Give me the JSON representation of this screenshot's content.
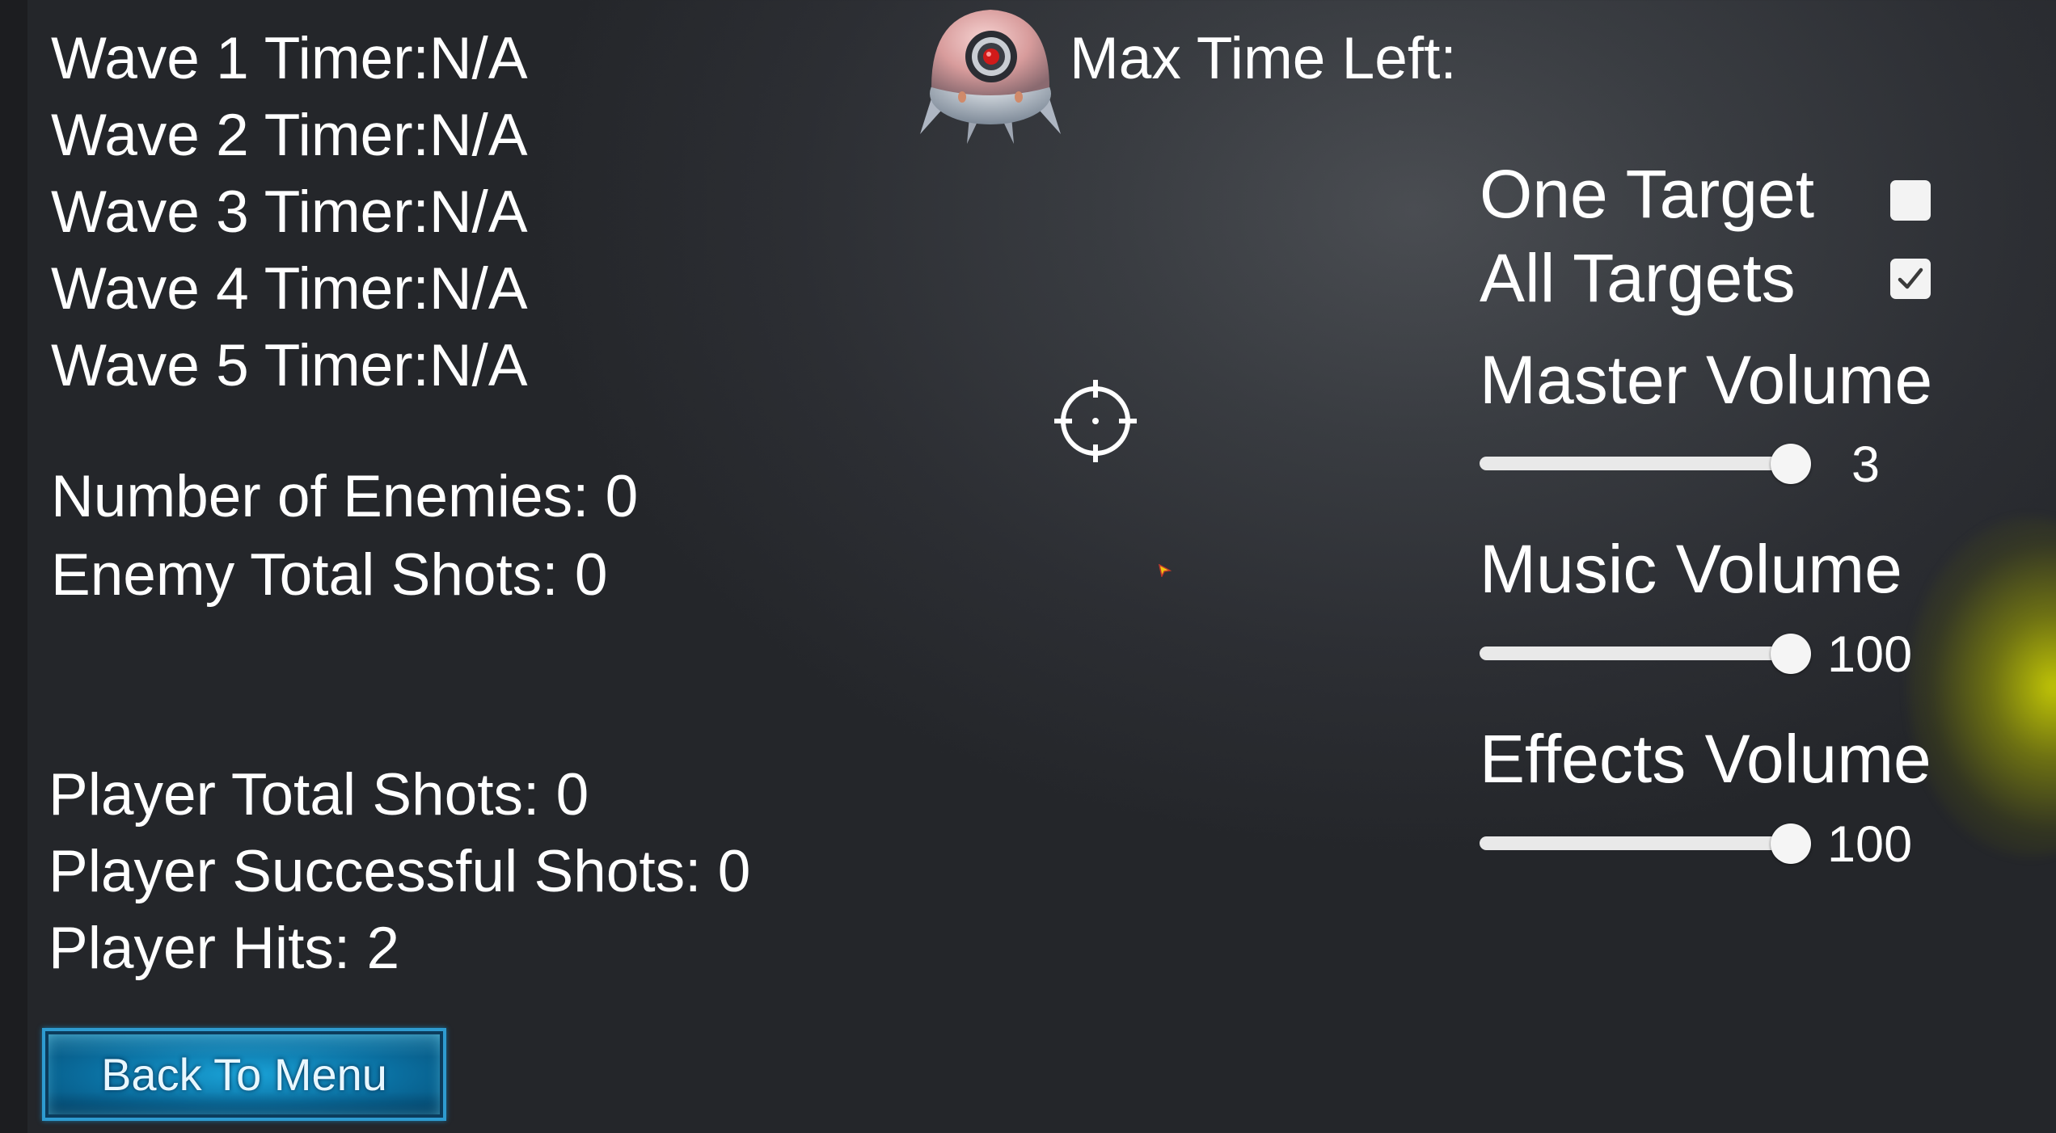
{
  "hud": {
    "wave_timers": [
      "Wave 1 Timer:N/A",
      "Wave 2 Timer:N/A",
      "Wave 3 Timer:N/A",
      "Wave 4 Timer:N/A",
      "Wave 5 Timer:N/A"
    ],
    "max_time_left": "Max Time Left:",
    "number_of_enemies": "Number of Enemies: 0",
    "enemy_total_shots": "Enemy Total Shots: 0",
    "player_total_shots": "Player Total Shots: 0",
    "player_successful_shots": "Player Successful Shots: 0",
    "player_hits": "Player Hits: 2"
  },
  "settings": {
    "one_target": {
      "label": "One Target",
      "checked": false
    },
    "all_targets": {
      "label": "All Targets",
      "checked": true
    },
    "master_volume": {
      "label": "Master Volume",
      "value": "3",
      "fill_fraction": 1.0
    },
    "music_volume": {
      "label": "Music Volume",
      "value": "100",
      "fill_fraction": 1.0
    },
    "effects_volume": {
      "label": "Effects Volume",
      "value": "100",
      "fill_fraction": 1.0
    }
  },
  "buttons": {
    "back_to_menu": "Back To Menu"
  },
  "icons": {
    "enemy_drone": "enemy-drone-icon",
    "crosshair": "crosshair-icon",
    "cursor": "mouse-cursor-icon"
  },
  "colors": {
    "button_accent": "#1aa3d8",
    "glow": "#dce100",
    "drone_eye": "#d21a1a"
  }
}
